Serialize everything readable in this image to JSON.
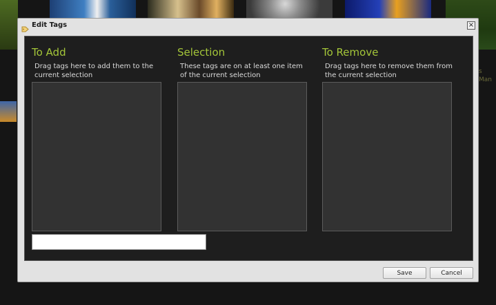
{
  "background": {
    "side_text": [
      "s",
      "Man"
    ]
  },
  "dialog": {
    "title": "Edit Tags",
    "close_label": "×",
    "columns": [
      {
        "title": "To Add",
        "description": "Drag tags here to add them to the current selection"
      },
      {
        "title": "Selection",
        "description": "These tags are on at least one item of the current selection"
      },
      {
        "title": "To Remove",
        "description": "Drag tags here to remove them from the current selection"
      }
    ],
    "tag_input": {
      "value": "",
      "placeholder": ""
    },
    "buttons": {
      "save": "Save",
      "cancel": "Cancel"
    }
  },
  "colors": {
    "accent_green": "#a4c639",
    "panel_dark": "#1e1e1e",
    "dropzone": "#323232"
  }
}
